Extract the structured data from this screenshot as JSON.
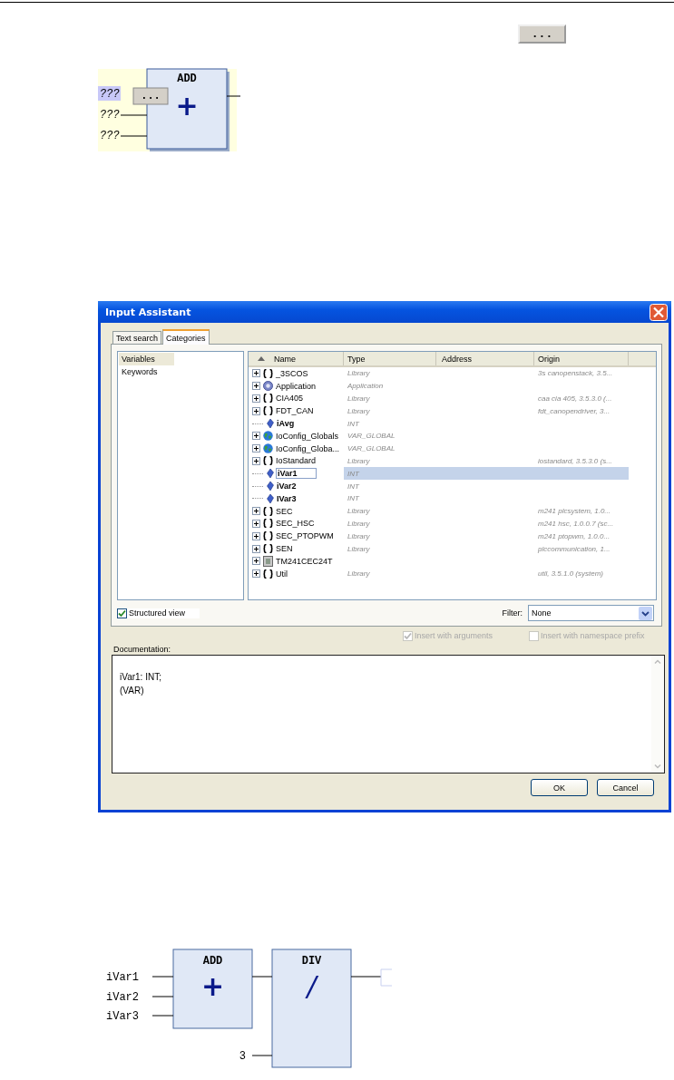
{
  "toolbar_button": {
    "label": "..."
  },
  "fbd_top": {
    "block": {
      "title": "ADD",
      "operator": "+"
    },
    "input_button": {
      "label": "..."
    },
    "inputs": [
      {
        "label": "???",
        "selected": true
      },
      {
        "label": "???",
        "selected": false
      },
      {
        "label": "???",
        "selected": false
      }
    ]
  },
  "dialog": {
    "title": "Input Assistant",
    "tabs": [
      {
        "label": "Text search",
        "selected": false
      },
      {
        "label": "Categories",
        "selected": true
      }
    ],
    "categories": [
      {
        "label": "Variables",
        "selected": true
      },
      {
        "label": "Keywords",
        "selected": false
      }
    ],
    "columns": [
      "Name",
      "Type",
      "Address",
      "Origin"
    ],
    "rows": [
      {
        "kind": "library",
        "name": "_3SCOS",
        "type": "Library",
        "origin": "3s canopenstack, 3.5...",
        "selected": false
      },
      {
        "kind": "application",
        "name": "Application",
        "type": "Application",
        "selected": false
      },
      {
        "kind": "library",
        "name": "CIA405",
        "type": "Library",
        "origin": "caa cia 405, 3.5.3.0 (...",
        "selected": false
      },
      {
        "kind": "library",
        "name": "FDT_CAN",
        "type": "Library",
        "origin": "fdt_canopendriver, 3...",
        "selected": false
      },
      {
        "kind": "variable",
        "name": "iAvg",
        "type": "INT",
        "selected": false
      },
      {
        "kind": "global",
        "name": "IoConfig_Globals",
        "type": "VAR_GLOBAL",
        "selected": false
      },
      {
        "kind": "global",
        "name": "IoConfig_Globa...",
        "type": "VAR_GLOBAL",
        "selected": false
      },
      {
        "kind": "library",
        "name": "IoStandard",
        "type": "Library",
        "origin": "iostandard, 3.5.3.0 (s...",
        "selected": false
      },
      {
        "kind": "variable",
        "name": "iVar1",
        "type": "INT",
        "selected": true
      },
      {
        "kind": "variable",
        "name": "iVar2",
        "type": "INT",
        "selected": false
      },
      {
        "kind": "variable",
        "name": "IVar3",
        "type": "INT",
        "selected": false
      },
      {
        "kind": "library",
        "name": "SEC",
        "type": "Library",
        "origin": "m241 plcsystem, 1.0...",
        "selected": false
      },
      {
        "kind": "library",
        "name": "SEC_HSC",
        "type": "Library",
        "origin": "m241 hsc, 1.0.0.7 (sc...",
        "selected": false
      },
      {
        "kind": "library",
        "name": "SEC_PTOPWM",
        "type": "Library",
        "origin": "m241 ptopwm, 1.0.0...",
        "selected": false
      },
      {
        "kind": "library",
        "name": "SEN",
        "type": "Library",
        "origin": "plccommunication, 1...",
        "selected": false
      },
      {
        "kind": "device",
        "name": "TM241CEC24T",
        "selected": false
      },
      {
        "kind": "library",
        "name": "Util",
        "type": "Library",
        "origin": "util, 3.5.1.0 (system)",
        "selected": false
      }
    ],
    "structured_view": {
      "label": "Structured view",
      "checked": true
    },
    "filter": {
      "label": "Filter:",
      "value": "None"
    },
    "options": [
      {
        "label": "Insert with arguments",
        "checked": true,
        "disabled": true
      },
      {
        "label": "Insert with namespace prefix",
        "checked": false,
        "disabled": true
      }
    ],
    "documentation": {
      "label": "Documentation:",
      "lines": [
        "iVar1: INT;",
        "(VAR)"
      ]
    },
    "buttons": [
      "OK",
      "Cancel"
    ]
  },
  "fbd_bottom": {
    "add_block": {
      "title": "ADD",
      "operator": "+",
      "inputs": [
        "iVar1",
        "iVar2",
        "iVar3"
      ]
    },
    "div_block": {
      "title": "DIV",
      "operator": "/",
      "inputs": [
        "3"
      ]
    }
  }
}
